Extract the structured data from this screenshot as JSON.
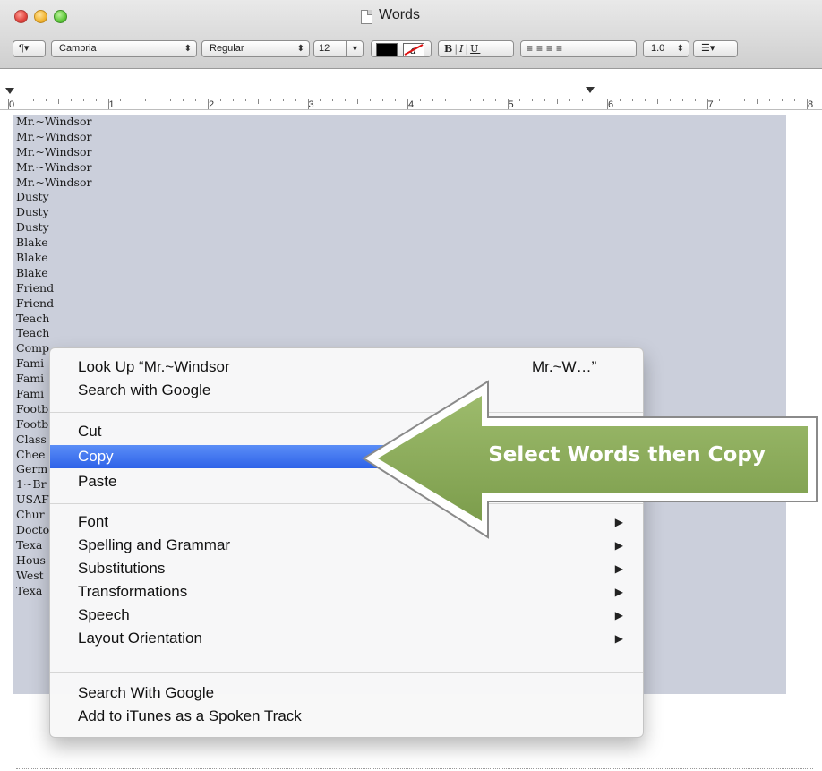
{
  "window": {
    "title": "Words"
  },
  "format_bar": {
    "paragraph_style": "¶▾",
    "font_family": "Cambria",
    "font_style": "Regular",
    "font_size": "12",
    "bold": "B",
    "italic": "I",
    "underline": "U",
    "line_spacing": "1.0",
    "list_style": "☰▾",
    "text_color": "#000000",
    "highlight_color": "#ffffff"
  },
  "ruler": {
    "numbers": [
      "0",
      "1",
      "2",
      "3",
      "4",
      "5",
      "6",
      "7",
      "8"
    ]
  },
  "document": {
    "lines": [
      "Mr.~Windsor",
      "Mr.~Windsor",
      "Mr.~Windsor",
      "Mr.~Windsor",
      "Mr.~Windsor",
      "Dusty",
      "Dusty",
      "Dusty",
      "Blake",
      "Blake",
      "Blake",
      "Friend",
      "Friend",
      "Teach",
      "Teach",
      "Comp",
      "Fami",
      "Fami",
      "Fami",
      "Footb",
      "Footb",
      "Class",
      "Chee",
      "Germ",
      "1~Br",
      "USAF",
      "Chur",
      "Docto",
      "Texa",
      "Hous",
      "West",
      "Texa"
    ],
    "selection_color": "#cbcfdb"
  },
  "context_menu": {
    "look_up": "Look Up “Mr.~Windsor",
    "look_up_tail": "Mr.~W…”",
    "search_google": "Search with Google",
    "cut": "Cut",
    "copy": "Copy",
    "paste": "Paste",
    "font": "Font",
    "spelling": "Spelling and Grammar",
    "substitutions": "Substitutions",
    "transformations": "Transformations",
    "speech": "Speech",
    "layout": "Layout Orientation",
    "search_google2": "Search With Google",
    "itunes": "Add to iTunes as a Spoken Track",
    "submenu_icon": "▶",
    "highlight_color": "#3d70f0"
  },
  "callout": {
    "text": "Select  Words then Copy",
    "color": "#8aab58"
  }
}
